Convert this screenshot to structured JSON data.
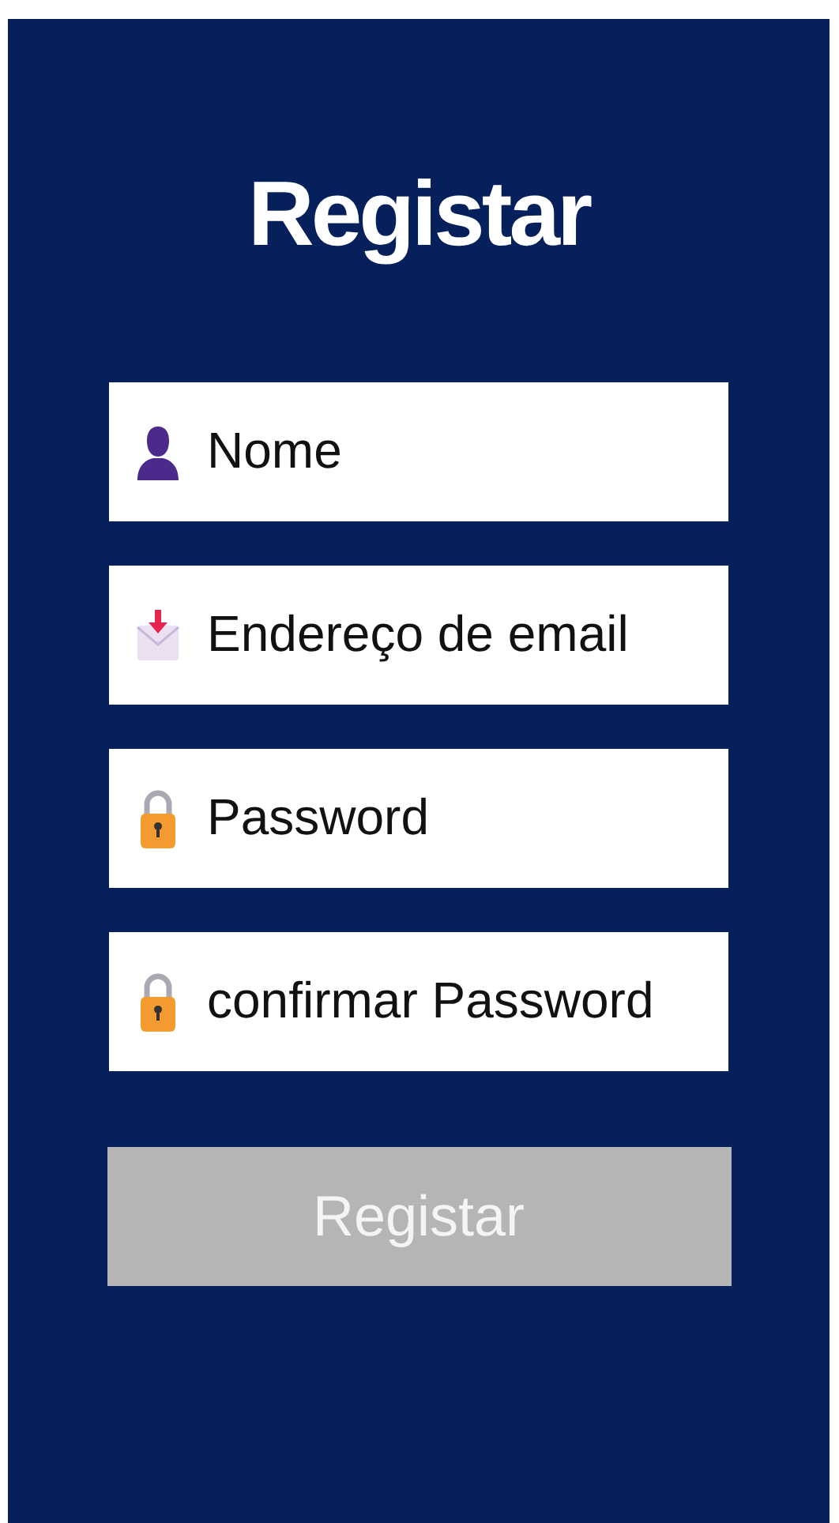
{
  "title": "Registar",
  "fields": [
    {
      "kind": "person",
      "placeholder": "Nome"
    },
    {
      "kind": "mail",
      "placeholder": "Endereço de email"
    },
    {
      "kind": "lock",
      "placeholder": "Password"
    },
    {
      "kind": "lock",
      "placeholder": "confirmar Password"
    }
  ],
  "submit": {
    "label": "Registar",
    "disabled": true
  }
}
